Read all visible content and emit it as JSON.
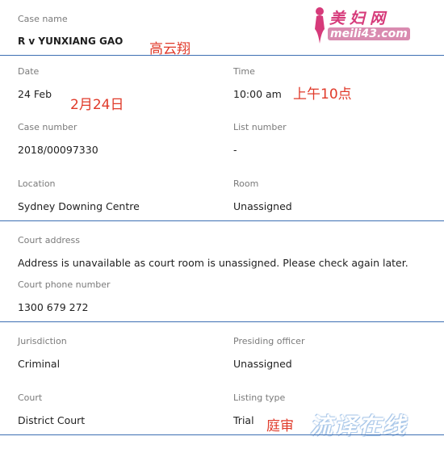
{
  "case_name": {
    "label": "Case name",
    "value": "R v YUNXIANG GAO",
    "note": "高云翔"
  },
  "date": {
    "label": "Date",
    "value": "24 Feb",
    "note": "2月24日"
  },
  "time": {
    "label": "Time",
    "value": "10:00 am",
    "note": "上午10点"
  },
  "case_number": {
    "label": "Case number",
    "value": "2018/00097330"
  },
  "list_number": {
    "label": "List number",
    "value": "-"
  },
  "location": {
    "label": "Location",
    "value": "Sydney Downing Centre"
  },
  "room": {
    "label": "Room",
    "value": "Unassigned"
  },
  "court_address": {
    "label": "Court address",
    "value": "Address is unavailable as court room is unassigned. Please check again later."
  },
  "court_phone": {
    "label": "Court phone number",
    "value": "1300 679 272"
  },
  "jurisdiction": {
    "label": "Jurisdiction",
    "value": "Criminal"
  },
  "presiding_officer": {
    "label": "Presiding officer",
    "value": "Unassigned"
  },
  "court": {
    "label": "Court",
    "value": "District Court"
  },
  "listing_type": {
    "label": "Listing type",
    "value": "Trial",
    "note": "庭审"
  },
  "watermark": {
    "site_name": "美妇网",
    "site_url": "meili43.com",
    "bottom_text": "流译在线"
  },
  "colors": {
    "rule": "#3d6fb3",
    "note": "#e03a2a",
    "label": "#7a7a7a",
    "watermark_pink": "#d63a7a"
  }
}
